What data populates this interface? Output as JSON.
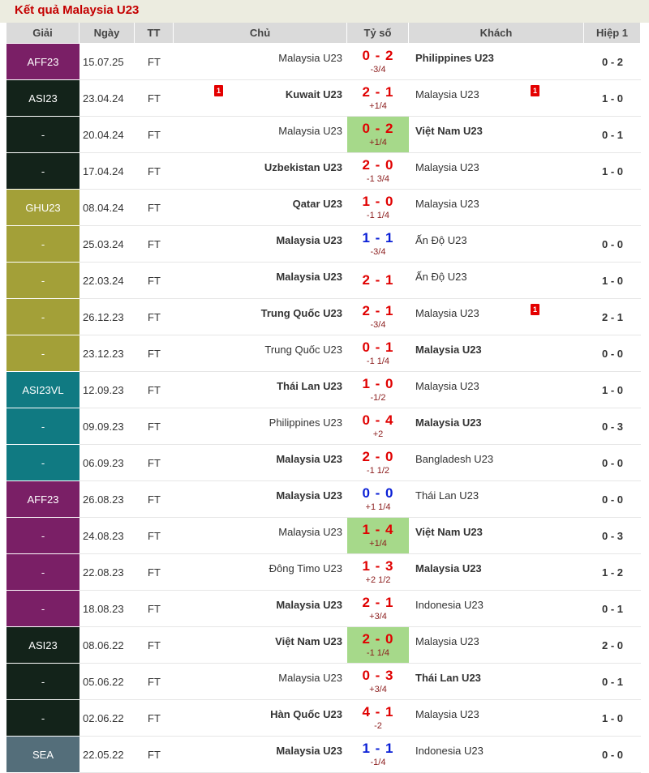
{
  "title": "Kết quả Malaysia U23",
  "headers": [
    "Giải",
    "Ngày",
    "TT",
    "Chủ",
    "Tỷ số",
    "Khách",
    "Hiệp 1"
  ],
  "colors": {
    "AFF23": "#7a1f66",
    "ASI23": "#13231a",
    "GHU23": "#a3a038",
    "ASI23VL": "#107a82",
    "SEA": "#546e7a",
    "win_cell": "#a6d98a",
    "score_red": "#e00000",
    "score_blue": "#0a1fd6"
  },
  "rows": [
    {
      "league": "AFF23",
      "date": "15.07.25",
      "status": "FT",
      "home": "Malaysia U23",
      "score": "0 - 2",
      "handicap": "-3/4",
      "away": "Philippines U23",
      "ht": "0 - 2"
    },
    {
      "league": "ASI23",
      "date": "23.04.24",
      "status": "FT",
      "home": "Kuwait U23",
      "home_card": "1",
      "score": "2 - 1",
      "handicap": "+1/4",
      "away": "Malaysia U23",
      "away_card": "1",
      "ht": "1 - 0"
    },
    {
      "league": "-",
      "date": "20.04.24",
      "status": "FT",
      "home": "Malaysia U23",
      "score": "0 - 2",
      "handicap": "+1/4",
      "away": "Việt Nam U23",
      "ht": "0 - 1"
    },
    {
      "league": "-",
      "date": "17.04.24",
      "status": "FT",
      "home": "Uzbekistan U23",
      "score": "2 - 0",
      "handicap": "-1 3/4",
      "away": "Malaysia U23",
      "ht": "1 - 0"
    },
    {
      "league": "GHU23",
      "date": "08.04.24",
      "status": "FT",
      "home": "Qatar U23",
      "score": "1 - 0",
      "handicap": "-1 1/4",
      "away": "Malaysia U23",
      "ht": ""
    },
    {
      "league": "-",
      "date": "25.03.24",
      "status": "FT",
      "home": "Malaysia U23",
      "score": "1 - 1",
      "handicap": "-3/4",
      "away": "Ấn Độ U23",
      "ht": "0 - 0"
    },
    {
      "league": "-",
      "date": "22.03.24",
      "status": "FT",
      "home": "Malaysia U23",
      "score": "2 - 1",
      "handicap": "",
      "away": "Ấn Độ U23",
      "ht": "1 - 0"
    },
    {
      "league": "-",
      "date": "26.12.23",
      "status": "FT",
      "home": "Trung Quốc U23",
      "score": "2 - 1",
      "handicap": "-3/4",
      "away": "Malaysia U23",
      "away_card": "1",
      "ht": "2 - 1"
    },
    {
      "league": "-",
      "date": "23.12.23",
      "status": "FT",
      "home": "Trung Quốc U23",
      "score": "0 - 1",
      "handicap": "-1 1/4",
      "away": "Malaysia U23",
      "ht": "0 - 0"
    },
    {
      "league": "ASI23VL",
      "date": "12.09.23",
      "status": "FT",
      "home": "Thái Lan U23",
      "score": "1 - 0",
      "handicap": "-1/2",
      "away": "Malaysia U23",
      "ht": "1 - 0"
    },
    {
      "league": "-",
      "date": "09.09.23",
      "status": "FT",
      "home": "Philippines U23",
      "score": "0 - 4",
      "handicap": "+2",
      "away": "Malaysia U23",
      "ht": "0 - 3"
    },
    {
      "league": "-",
      "date": "06.09.23",
      "status": "FT",
      "home": "Malaysia U23",
      "score": "2 - 0",
      "handicap": "-1 1/2",
      "away": "Bangladesh U23",
      "ht": "0 - 0"
    },
    {
      "league": "AFF23",
      "date": "26.08.23",
      "status": "FT",
      "home": "Malaysia U23",
      "score": "0 - 0",
      "handicap": "+1 1/4",
      "away": "Thái Lan U23",
      "ht": "0 - 0"
    },
    {
      "league": "-",
      "date": "24.08.23",
      "status": "FT",
      "home": "Malaysia U23",
      "score": "1 - 4",
      "handicap": "+1/4",
      "away": "Việt Nam U23",
      "ht": "0 - 3"
    },
    {
      "league": "-",
      "date": "22.08.23",
      "status": "FT",
      "home": "Đông Timo U23",
      "score": "1 - 3",
      "handicap": "+2 1/2",
      "away": "Malaysia U23",
      "ht": "1 - 2"
    },
    {
      "league": "-",
      "date": "18.08.23",
      "status": "FT",
      "home": "Malaysia U23",
      "score": "2 - 1",
      "handicap": "+3/4",
      "away": "Indonesia U23",
      "ht": "0 - 1"
    },
    {
      "league": "ASI23",
      "date": "08.06.22",
      "status": "FT",
      "home": "Việt Nam U23",
      "score": "2 - 0",
      "handicap": "-1 1/4",
      "away": "Malaysia U23",
      "ht": "2 - 0"
    },
    {
      "league": "-",
      "date": "05.06.22",
      "status": "FT",
      "home": "Malaysia U23",
      "score": "0 - 3",
      "handicap": "+3/4",
      "away": "Thái Lan U23",
      "ht": "0 - 1"
    },
    {
      "league": "-",
      "date": "02.06.22",
      "status": "FT",
      "home": "Hàn Quốc U23",
      "score": "4 - 1",
      "handicap": "-2",
      "away": "Malaysia U23",
      "ht": "1 - 0"
    },
    {
      "league": "SEA",
      "date": "22.05.22",
      "status": "FT",
      "home": "Malaysia U23",
      "score": "1 - 1",
      "handicap": "-1/4",
      "away": "Indonesia U23",
      "ht": "0 - 0"
    }
  ]
}
